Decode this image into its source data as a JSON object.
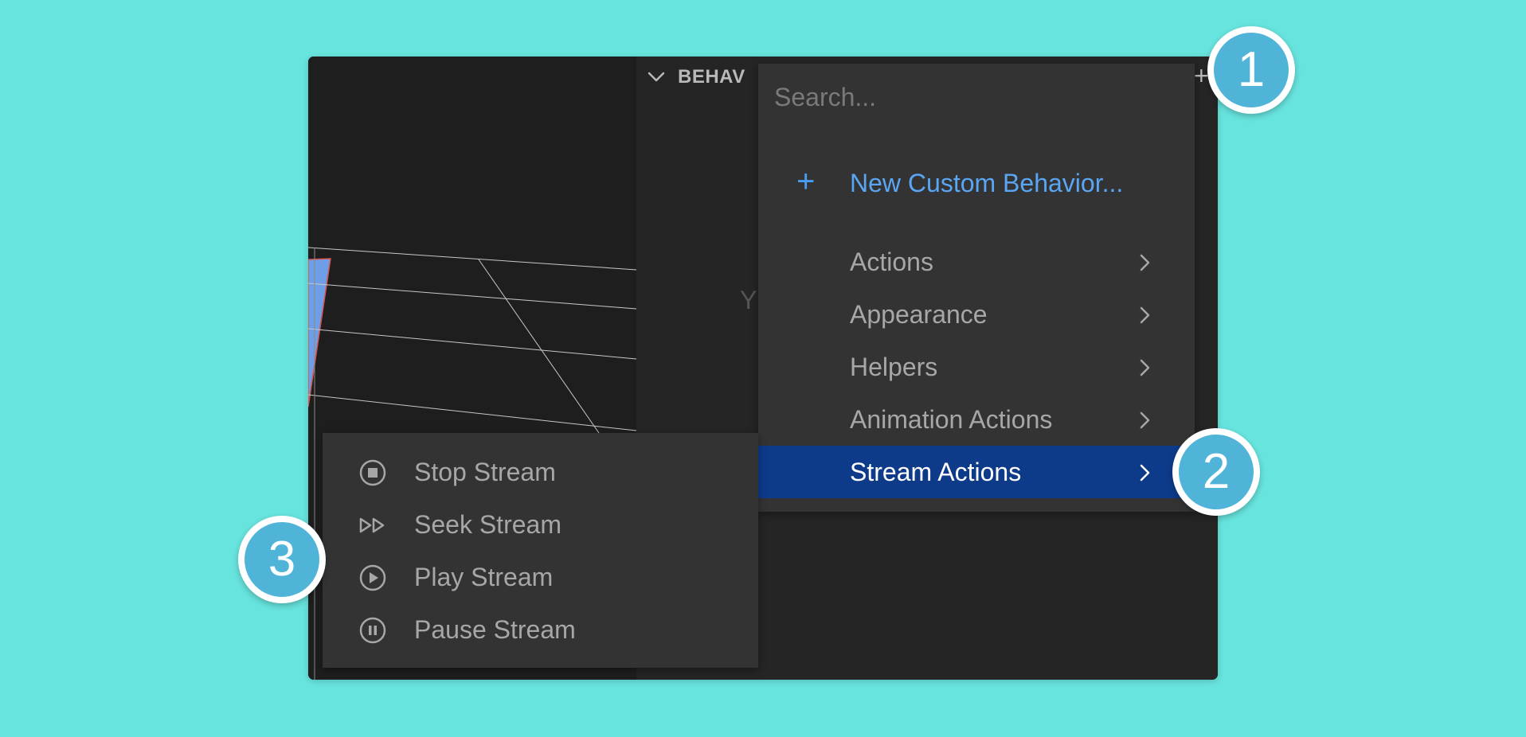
{
  "colors": {
    "background": "#68e4de",
    "window": "#1e1e1e",
    "menu": "#333333",
    "accent_blue": "#5aa6f4",
    "active_item": "#0e3a8a",
    "callout": "#4fb4d8"
  },
  "panel": {
    "title": "BEHAV",
    "add_glyph": "+",
    "empty_hint": "Y",
    "collapse_icon": "chevron-down-icon"
  },
  "menu": {
    "search_placeholder": "Search...",
    "new_custom_icon": "+",
    "new_custom_label": "New Custom Behavior...",
    "items": [
      {
        "label": "Actions"
      },
      {
        "label": "Appearance"
      },
      {
        "label": "Helpers"
      },
      {
        "label": "Animation Actions"
      },
      {
        "label": "Stream Actions",
        "active": true
      }
    ]
  },
  "submenu": {
    "items": [
      {
        "label": "Stop Stream",
        "icon": "stop-circle-icon"
      },
      {
        "label": "Seek Stream",
        "icon": "fast-forward-icon"
      },
      {
        "label": "Play Stream",
        "icon": "play-circle-icon"
      },
      {
        "label": "Pause Stream",
        "icon": "pause-circle-icon"
      }
    ]
  },
  "callouts": [
    "1",
    "2",
    "3"
  ]
}
